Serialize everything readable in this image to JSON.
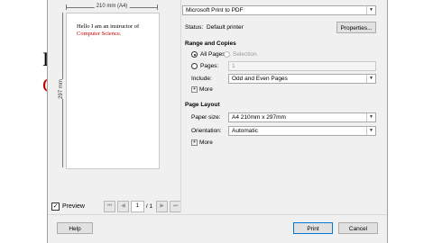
{
  "background_doc": {
    "line1_fragment": "I",
    "line2_fragment": "C"
  },
  "preview": {
    "ruler_width_label": "210 mm (A4)",
    "ruler_height_label": "297 mm",
    "page_line1": "Hello I am an instructor of",
    "page_line2": "Computer Science."
  },
  "navigation": {
    "preview_label": "Preview",
    "preview_checked": true,
    "first_icon": "first-page-icon",
    "prev_icon": "previous-page-icon",
    "next_icon": "next-page-icon",
    "last_icon": "last-page-icon",
    "current_page": "1",
    "total_pages": "/ 1"
  },
  "printer": {
    "selected": "Microsoft Print to PDF",
    "status_label": "Status:",
    "status_value": "Default printer",
    "properties_label": "Properties..."
  },
  "range": {
    "heading": "Range and Copies",
    "all_pages_label": "All Pages",
    "selection_label": "Selection",
    "pages_label": "Pages:",
    "pages_value": "1",
    "include_label": "Include:",
    "include_value": "Odd and Even Pages",
    "more_label": "More"
  },
  "layout": {
    "heading": "Page Layout",
    "paper_size_label": "Paper size:",
    "paper_size_value": "A4 210mm x 297mm",
    "orientation_label": "Orientation:",
    "orientation_value": "Automatic",
    "more_label": "More"
  },
  "buttons": {
    "help": "Help",
    "print": "Print",
    "cancel": "Cancel"
  }
}
